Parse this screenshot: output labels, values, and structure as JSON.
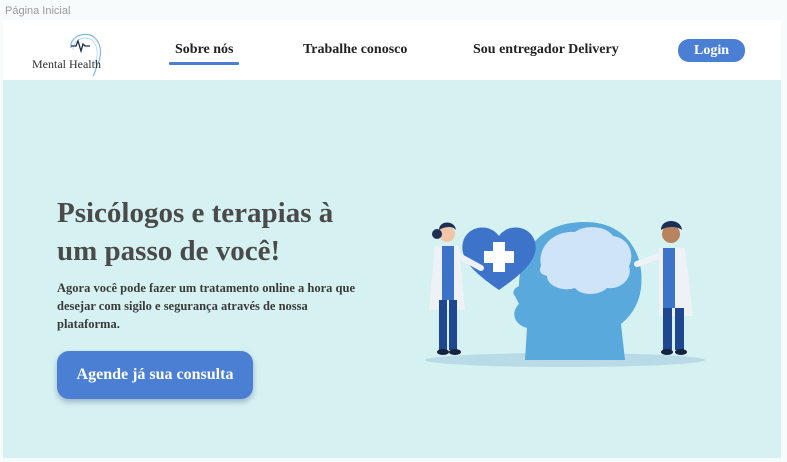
{
  "window": {
    "title": "Página Inicial"
  },
  "logo": {
    "text": "Mental Health",
    "icon": "heartbeat-icon"
  },
  "nav": {
    "links": [
      {
        "label": "Sobre nós",
        "active": true
      },
      {
        "label": "Trabalhe conosco",
        "active": false
      },
      {
        "label": "Sou entregador Delivery",
        "active": false
      }
    ],
    "login_label": "Login"
  },
  "hero": {
    "title": "Psicólogos e terapias à um passo de você!",
    "description": "Agora você pode fazer um tratamento online a hora que desejar com sigilo e segurança através de nossa plataforma.",
    "cta_label": "Agende já sua consulta",
    "illustration_icon": "mental-health-illustration"
  },
  "colors": {
    "accent": "#4a7fd4",
    "hero_background": "#d6f1f1",
    "nav_background": "#ffffff"
  }
}
